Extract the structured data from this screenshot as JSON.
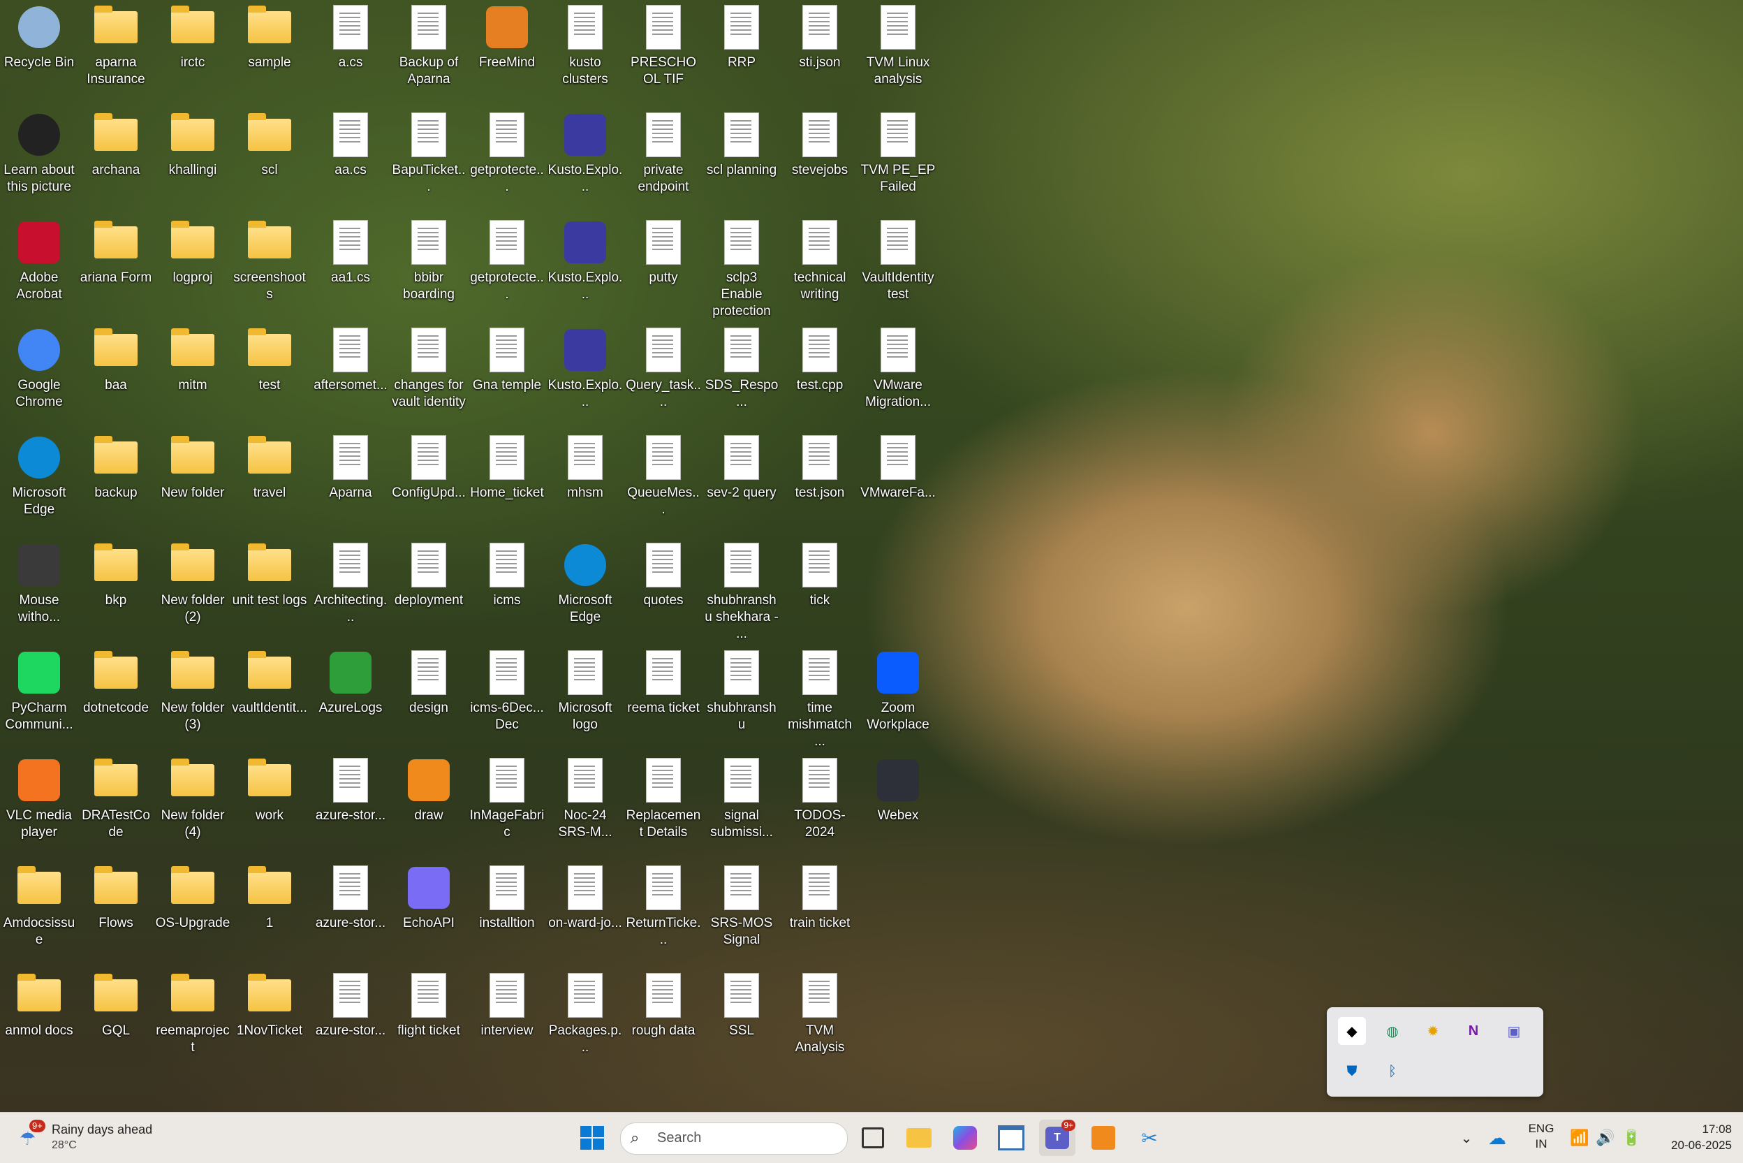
{
  "desktop": {
    "columns": [
      [
        "Recycle Bin",
        "Learn about this picture",
        "Adobe Acrobat",
        "Google Chrome",
        "Microsoft Edge",
        "Mouse witho...",
        "PyCharm Communi...",
        "VLC media player",
        "Amdocsissue",
        "anmol docs"
      ],
      [
        "aparna Insurance",
        "archana",
        "ariana Form",
        "baa",
        "backup",
        "bkp",
        "dotnetcode",
        "DRATestCode",
        "Flows",
        "GQL"
      ],
      [
        "irctc",
        "khallingi",
        "logproj",
        "mitm",
        "New folder",
        "New folder (2)",
        "New folder (3)",
        "New folder (4)",
        "OS-Upgrade",
        "reemaproject"
      ],
      [
        "sample",
        "scl",
        "screenshoots",
        "test",
        "travel",
        "unit test logs",
        "vaultIdentit...",
        "work",
        "1",
        "1NovTicket"
      ],
      [
        "a.cs",
        "aa.cs",
        "aa1.cs",
        "aftersomet...",
        "Aparna",
        "Architecting...",
        "AzureLogs",
        "azure-stor...",
        "azure-stor...",
        "azure-stor..."
      ],
      [
        "Backup of Aparna",
        "BapuTicket...",
        "bbibr boarding",
        "changes for vault identity",
        "ConfigUpd...",
        "deployment",
        "design",
        "draw",
        "EchoAPI",
        "flight ticket"
      ],
      [
        "FreeMind",
        "getprotecte...",
        "getprotecte...",
        "Gna temple",
        "Home_ticket",
        "icms",
        "icms-6Dec... Dec",
        "InMageFabric",
        "installtion",
        "interview"
      ],
      [
        "kusto clusters",
        "Kusto.Explo...",
        "Kusto.Explo...",
        "Kusto.Explo...",
        "mhsm",
        "Microsoft Edge",
        "Microsoft logo",
        "Noc-24 SRS-M...",
        "on-ward-jo...",
        "Packages.p..."
      ],
      [
        "PRESCHOOL TIF",
        "private endpoint",
        "putty",
        "Query_task....",
        "QueueMes...",
        "quotes",
        "reema ticket",
        "Replacement Details",
        "ReturnTicke...",
        "rough data"
      ],
      [
        "RRP",
        "scl planning",
        "sclp3 Enable protection",
        "SDS_Respo...",
        "sev-2 query",
        "shubhranshu shekhara - ...",
        "shubhranshu",
        "signal submissi...",
        "SRS-MOS Signal",
        "SSL"
      ],
      [
        "sti.json",
        "stevejobs",
        "technical writing",
        "test.cpp",
        "test.json",
        "tick",
        "time mishmatch ...",
        "TODOS-2024",
        "train ticket",
        "TVM Analysis"
      ],
      [
        "TVM Linux analysis",
        "TVM PE_EP Failed",
        "VaultIdentity test",
        "VMware Migration...",
        "VMwareFa...",
        "",
        "Zoom Workplace",
        "Webex",
        "",
        ""
      ]
    ]
  },
  "taskbar": {
    "weather": {
      "title": "Rainy days ahead",
      "temp": "28°C",
      "badge": "9+"
    },
    "search_placeholder": "Search",
    "teams_badge": "9+",
    "lang_primary": "ENG",
    "lang_secondary": "IN",
    "time": "17:08",
    "date": "20-06-2025"
  },
  "colors": {
    "taskbar_bg": "#ece9e4",
    "folder": "#f6c343",
    "accent": "#0067c0",
    "badge": "#c42b1c"
  }
}
